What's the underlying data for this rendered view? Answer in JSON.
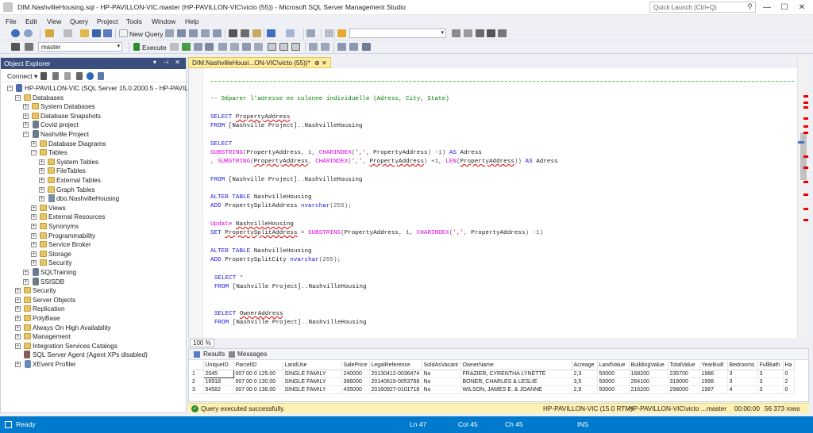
{
  "window": {
    "title": "DIM.NashvilleHousing.sql - HP-PAVILLON-VIC.master (HP-PAVILLON-VIC\\victo (55)) - Microsoft SQL Server Management Studio",
    "quick_launch_placeholder": "Quick Launch (Ctrl+Q)",
    "buttons": [
      "—",
      "☐",
      "✕"
    ]
  },
  "menu": [
    "File",
    "Edit",
    "View",
    "Query",
    "Project",
    "Tools",
    "Window",
    "Help"
  ],
  "toolbar": {
    "new_query_label": "New Query",
    "database_value": "master",
    "execute_label": "Execute"
  },
  "object_explorer": {
    "title": "Object Explorer",
    "pin_controls": "▾ ⊣ ✕",
    "connect_label": "Connect ▾",
    "nodes": [
      {
        "label": "HP-PAVILLON-VIC (SQL Server 15.0.2000.5 - HP-PAVILLON-VIC\\victo)",
        "exp": "−"
      },
      {
        "label": "Databases",
        "exp": "−"
      },
      {
        "label": "System Databases",
        "exp": "+"
      },
      {
        "label": "Database Snapshots",
        "exp": "+"
      },
      {
        "label": "Covid project",
        "exp": "+"
      },
      {
        "label": "Nashville Project",
        "exp": "−"
      },
      {
        "label": "Database Diagrams",
        "exp": "+"
      },
      {
        "label": "Tables",
        "exp": "−"
      },
      {
        "label": "System Tables",
        "exp": "+"
      },
      {
        "label": "FileTables",
        "exp": "+"
      },
      {
        "label": "External Tables",
        "exp": "+"
      },
      {
        "label": "Graph Tables",
        "exp": "+"
      },
      {
        "label": "dbo.NashvilleHousing",
        "exp": "+"
      },
      {
        "label": "Views",
        "exp": "+"
      },
      {
        "label": "External Resources",
        "exp": "+"
      },
      {
        "label": "Synonyms",
        "exp": "+"
      },
      {
        "label": "Programmability",
        "exp": "+"
      },
      {
        "label": "Service Broker",
        "exp": "+"
      },
      {
        "label": "Storage",
        "exp": "+"
      },
      {
        "label": "Security",
        "exp": "+"
      },
      {
        "label": "SQLTraining",
        "exp": "+"
      },
      {
        "label": "SSISDB",
        "exp": "+"
      },
      {
        "label": "Security",
        "exp": "+"
      },
      {
        "label": "Server Objects",
        "exp": "+"
      },
      {
        "label": "Replication",
        "exp": "+"
      },
      {
        "label": "PolyBase",
        "exp": "+"
      },
      {
        "label": "Always On High Availability",
        "exp": "+"
      },
      {
        "label": "Management",
        "exp": "+"
      },
      {
        "label": "Integration Services Catalogs",
        "exp": "+"
      },
      {
        "label": "SQL Server Agent (Agent XPs disabled)",
        "exp": ""
      },
      {
        "label": "XEvent Profiler",
        "exp": "+"
      }
    ]
  },
  "editor": {
    "tab_label": "DIM.NashvilleHousi...ON-VIC\\victo (55))*",
    "tab_controls": "⊕ ✕",
    "comment": "-- Séparer l'adresse en colonne individuelle (Adress, City, State)",
    "code": {
      "l1a": "SELECT",
      "l1b": "PropertyAddress",
      "l2a": "FROM",
      "l2b": "[Nashville Project]",
      "l2c": "..",
      "l2d": "NashvilleHousing",
      "l3": "SELECT",
      "l4a": "SUBSTRING",
      "l4b": "(",
      "l4c": "PropertyAddress",
      "l4d": ", 1, ",
      "l4e": "CHARINDEX",
      "l4f": "(",
      "l4g": "','",
      "l4h": ", ",
      "l4i": "PropertyAddress",
      "l4j": ") -1)",
      "l4k": "AS",
      "l4l": "Adress",
      "l5a": ", ",
      "l5b": "SUBSTRING",
      "l5c": "(",
      "l5d": "PropertyAddress",
      "l5e": ", ",
      "l5f": "CHARINDEX",
      "l5g": "(",
      "l5h": "','",
      "l5i": ", ",
      "l5j": "PropertyAddress",
      "l5k": ") +1, ",
      "l5l": "LEN",
      "l5m": "(",
      "l5n": "PropertyAddress",
      "l5o": "))",
      "l5p": "AS",
      "l5q": "Adress",
      "l6a": "FROM",
      "l6b": "[Nashville Project]",
      "l6c": "..",
      "l6d": "NashvilleHousing",
      "l7a": "ALTER TABLE",
      "l7b": "NashvilleHousing",
      "l8a": "ADD",
      "l8b": "PropertySplitAddress",
      "l8c": "nvarchar",
      "l8d": "(255);",
      "l9a": "Update",
      "l9b": "NashvilleHousing",
      "l10a": "SET",
      "l10b": "PropertySplitAddress",
      "l10c": " = ",
      "l10d": "SUBSTRING",
      "l10e": "(",
      "l10f": "PropertyAddress",
      "l10g": ", 1, ",
      "l10h": "CHARINDEX",
      "l10i": "(",
      "l10j": "','",
      "l10k": ", ",
      "l10l": "PropertyAddress",
      "l10m": ") -1)",
      "l11a": "ALTER TABLE",
      "l11b": "NashvilleHousing",
      "l12a": "ADD",
      "l12b": "PropertySplitCity",
      "l12c": "nvarchar",
      "l12d": "(255);",
      "l13a": "SELECT",
      "l13b": "*",
      "l14a": "FROM",
      "l14b": "[Nashville Project]",
      "l14c": "..",
      "l14d": "NashvilleHousing",
      "l15a": "SELECT",
      "l15b": "OwnerAddress",
      "l16a": "FROM",
      "l16b": "[Nashville Project]",
      "l16c": "..",
      "l16d": "NashvilleHousing"
    },
    "zoom": "100 %"
  },
  "results": {
    "tab_results": "Results",
    "tab_messages": "Messages",
    "columns": [
      "",
      "UniqueID",
      "ParcelID",
      "LandUse",
      "SalePrice",
      "LegalReference",
      "SoldAsVacant",
      "OwnerName",
      "Acreage",
      "LandValue",
      "BuildingValue",
      "TotalValue",
      "YearBuilt",
      "Bedrooms",
      "FullBath",
      "Ha"
    ],
    "rows": [
      [
        "1",
        "2045",
        "007 00 0 125.00",
        "SINGLE FAMILY",
        "240000",
        "20130412-0036474",
        "No",
        "FRAZIER, CYRENTHA LYNETTE",
        "2,3",
        "50000",
        "168200",
        "235700",
        "1986",
        "3",
        "3",
        "0"
      ],
      [
        "2",
        "16918",
        "007 00 0 130.00",
        "SINGLE FAMILY",
        "366000",
        "20140619-0053768",
        "No",
        "BONER, CHARLES & LESLIE",
        "3,5",
        "50000",
        "264100",
        "319000",
        "1998",
        "3",
        "3",
        "2"
      ],
      [
        "3",
        "54582",
        "007 00 0 138.00",
        "SINGLE FAMILY",
        "435000",
        "20160927-0101718",
        "No",
        "WILSON, JAMES E. & JOANNE",
        "2,9",
        "50000",
        "216200",
        "298000",
        "1987",
        "4",
        "3",
        "0"
      ]
    ]
  },
  "query_status": {
    "message": "Query executed successfully.",
    "server": "HP-PAVILLON-VIC (15.0 RTM)",
    "user": "HP-PAVILLON-VIC\\victo ...",
    "database": "master",
    "time": "00:00:00",
    "rows": "56 373 rows"
  },
  "statusbar": {
    "ready": "Ready",
    "ln": "Ln 47",
    "col": "Col 45",
    "ch": "Ch 45",
    "ins": "INS"
  },
  "colors": {
    "accent": "#007acc",
    "oe_header": "#3a4f7e",
    "tab_active": "#ffec9e",
    "keyword": "#1a1adb",
    "function": "#e000e0",
    "comment": "#008000"
  }
}
